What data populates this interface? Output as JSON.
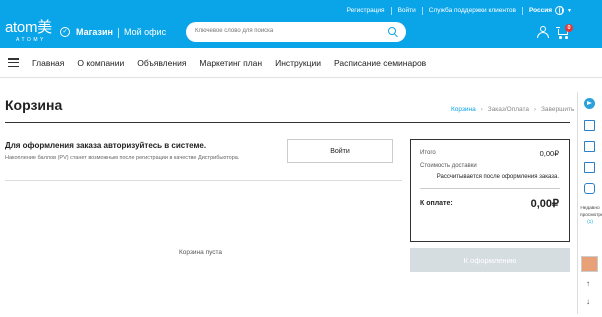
{
  "top_links": {
    "register": "Регистрация",
    "login": "Войти",
    "support": "Служба поддержки клиентов",
    "country": "Россия"
  },
  "logo": {
    "text": "atom美",
    "subtext": "ATOMY"
  },
  "header_nav": {
    "shop": "Магазин",
    "office": "Мой офис"
  },
  "search": {
    "placeholder": "Ключевое слово для поиска"
  },
  "cart": {
    "count": "0"
  },
  "main_menu": [
    "Главная",
    "О компании",
    "Объявления",
    "Маркетинг план",
    "Инструкции",
    "Расписание семинаров"
  ],
  "page": {
    "title": "Корзина",
    "breadcrumb": [
      "Корзина",
      "Заказ/Оплата",
      "Завершить"
    ]
  },
  "auth": {
    "title": "Для оформления заказа авторизуйтесь в системе.",
    "subtitle": "Накопление баллов (PV) станет возможным после регистрации в качестве Дистрибьютора.",
    "login_button": "Войти"
  },
  "empty_message": "Корзина пуста",
  "summary": {
    "total_label": "Итого",
    "total_value": "0,00₽",
    "delivery_label": "Стоимость доставки",
    "delivery_note": "Рассчитывается после оформления заказа.",
    "pay_label": "К оплате:",
    "pay_value": "0,00₽",
    "checkout_button": "К оформлению"
  },
  "sidebar": {
    "viewed_label": "Недавно просмотренные",
    "viewed_count": "(1)"
  },
  "colors": {
    "brand": "#0aa4e8",
    "badge": "#e53935",
    "disabled_button": "#d6dde1"
  }
}
